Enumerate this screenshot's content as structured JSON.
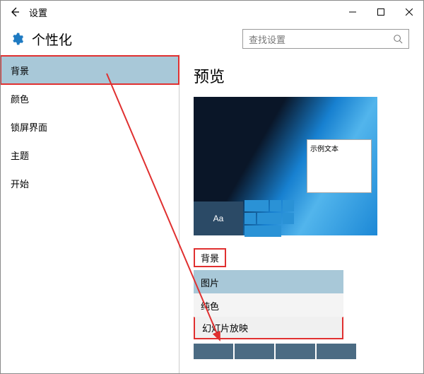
{
  "titlebar": {
    "title": "设置"
  },
  "header": {
    "crumb": "个性化"
  },
  "search": {
    "placeholder": "查找设置"
  },
  "sidebar": {
    "items": [
      {
        "label": "背景",
        "active": true
      },
      {
        "label": "颜色"
      },
      {
        "label": "锁屏界面"
      },
      {
        "label": "主题"
      },
      {
        "label": "开始"
      }
    ]
  },
  "main": {
    "preview_heading": "预览",
    "sample_text": "示例文本",
    "aa": "Aa",
    "bg_label": "背景",
    "combo": {
      "options": [
        {
          "label": "图片",
          "selected": true
        },
        {
          "label": "纯色"
        },
        {
          "label": "幻灯片放映"
        }
      ]
    }
  }
}
